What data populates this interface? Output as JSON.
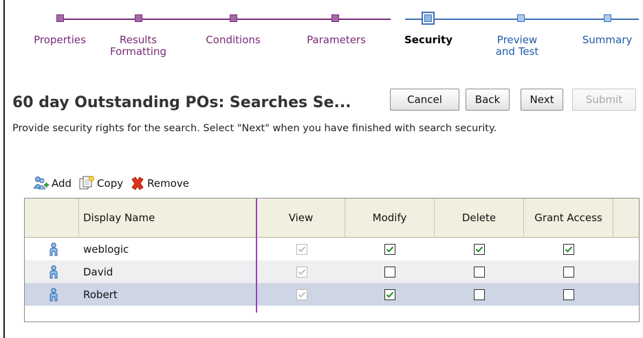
{
  "train": {
    "steps": [
      {
        "label": "Properties",
        "state": "visited"
      },
      {
        "label": "Results\nFormatting",
        "state": "visited"
      },
      {
        "label": "Conditions",
        "state": "visited"
      },
      {
        "label": "Parameters",
        "state": "visited"
      },
      {
        "label": "Security",
        "state": "current"
      },
      {
        "label": "Preview\nand Test",
        "state": "future"
      },
      {
        "label": "Summary",
        "state": "future"
      }
    ],
    "colors": {
      "visited": "#7a2a78",
      "future": "#3f6fb5"
    }
  },
  "header": {
    "title": "60 day Outstanding POs: Searches Se...",
    "buttons": {
      "cancel": "Cancel",
      "back": "Back",
      "next": "Next",
      "submit": "Submit"
    },
    "description": "Provide security rights for the search. Select \"Next\" when you have finished with search security."
  },
  "toolbar": {
    "add": "Add",
    "copy": "Copy",
    "remove": "Remove"
  },
  "table": {
    "columns": [
      "Display Name",
      "View",
      "Modify",
      "Delete",
      "Grant Access"
    ],
    "rows": [
      {
        "name": "weblogic",
        "view": true,
        "modify": true,
        "delete": true,
        "grant": true
      },
      {
        "name": "David",
        "view": true,
        "modify": false,
        "delete": false,
        "grant": false
      },
      {
        "name": "Robert",
        "view": true,
        "modify": true,
        "delete": false,
        "grant": false
      }
    ]
  }
}
